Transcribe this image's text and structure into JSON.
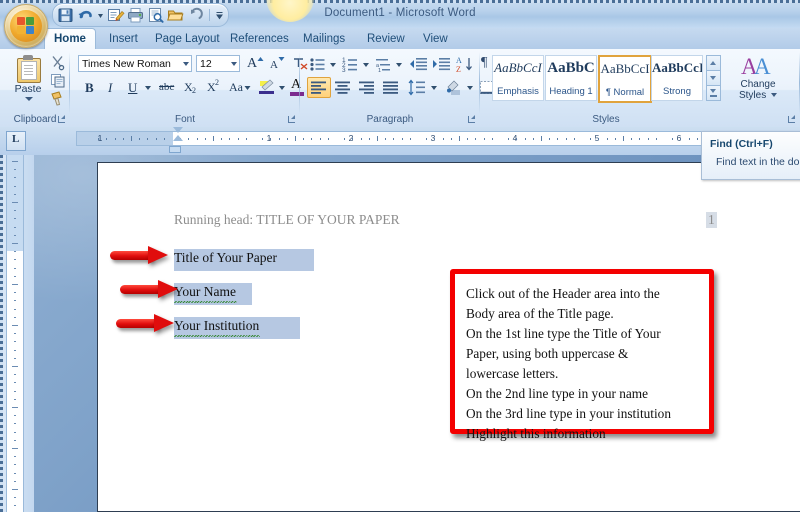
{
  "window": {
    "title": "Document1 - Microsoft Word",
    "office_button": "office-orb"
  },
  "quick_access": {
    "items": [
      {
        "name": "save-icon",
        "tip": "Save"
      },
      {
        "name": "undo-icon",
        "tip": "Undo"
      },
      {
        "name": "undo-dropdown-icon",
        "tip": "Undo options"
      },
      {
        "name": "quick-edit-icon",
        "tip": "Edit"
      },
      {
        "name": "print-icon",
        "tip": "Quick Print"
      },
      {
        "name": "print-preview-icon",
        "tip": "Print Preview"
      },
      {
        "name": "open-icon",
        "tip": "Open"
      },
      {
        "name": "redo-icon",
        "tip": "Redo"
      },
      {
        "name": "customize-qat-icon",
        "tip": "Customize Quick Access Toolbar"
      }
    ]
  },
  "ribbon": {
    "tabs": [
      {
        "label": "Home",
        "active": true
      },
      {
        "label": "Insert",
        "active": false
      },
      {
        "label": "Page Layout",
        "active": false
      },
      {
        "label": "References",
        "active": false
      },
      {
        "label": "Mailings",
        "active": false
      },
      {
        "label": "Review",
        "active": false
      },
      {
        "label": "View",
        "active": false
      }
    ],
    "groups": [
      {
        "label": "Clipboard"
      },
      {
        "label": "Font"
      },
      {
        "label": "Paragraph"
      },
      {
        "label": "Styles"
      }
    ],
    "clipboard": {
      "paste_label": "Paste",
      "cut_icon": "scissors-icon",
      "copy_icon": "copy-icon",
      "format_painter_icon": "format-painter-icon"
    },
    "font": {
      "font_name": "Times New Roman",
      "font_size": "12",
      "grow_font": "A",
      "shrink_font": "A",
      "clear_formatting_icon": "clear-formatting-icon",
      "bold": "B",
      "italic": "I",
      "underline": "U",
      "strikethrough": "abc",
      "subscript": "X",
      "superscript": "X",
      "change_case": "Aa",
      "highlight_icon": "text-highlight-icon",
      "font_color": "A"
    },
    "paragraph": {
      "bullets_icon": "bullets-icon",
      "numbering_icon": "numbering-icon",
      "multilevel_icon": "multilevel-list-icon",
      "decrease_indent_icon": "decrease-indent-icon",
      "increase_indent_icon": "increase-indent-icon",
      "sort_icon": "sort-icon",
      "show_marks_icon": "show-formatting-marks-icon",
      "align_left_icon": "align-left-icon",
      "align_center_icon": "align-center-icon",
      "align_right_icon": "align-right-icon",
      "justify_icon": "justify-icon",
      "line_spacing_icon": "line-spacing-icon",
      "shading_icon": "shading-icon",
      "borders_icon": "borders-icon"
    },
    "styles": {
      "gallery": [
        {
          "sample": "AaBbCcI",
          "name": "Emphasis",
          "selected": false
        },
        {
          "sample": "AaBbC",
          "name": "Heading 1",
          "selected": false
        },
        {
          "sample": "AaBbCcI",
          "name": "¶ Normal",
          "selected": true
        },
        {
          "sample": "AaBbCcI",
          "name": "Strong",
          "selected": false
        }
      ],
      "change_styles_line1": "Change",
      "change_styles_line2": "Styles"
    }
  },
  "ruler": {
    "tab_selector": "L",
    "h_numbers": [
      "1",
      "1",
      "2",
      "3",
      "4",
      "5",
      "6"
    ]
  },
  "tooltip": {
    "title": "Find (Ctrl+F)",
    "body": "Find text in the doc"
  },
  "document": {
    "header_text": "Running head: TITLE OF YOUR PAPER",
    "page_number": "1",
    "body_lines": [
      "Title of Your Paper",
      "Your Name",
      "Your Institution"
    ]
  },
  "callout": {
    "lines": [
      "Click out of the Header area into the",
      "Body area of the Title page.",
      "On the 1st line type the Title of Your",
      "Paper, using both uppercase &",
      "lowercase letters.",
      "On the 2nd line type in your name",
      "On the 3rd line type in your institution",
      "Highlight this information"
    ],
    "border_color": "#f40000"
  },
  "annotations": {
    "arrow_count": 3,
    "arrow_color": "#e00d0d"
  },
  "colors": {
    "selection_highlight": "#b6c8e2",
    "ribbon_accent": "#1f4e79",
    "active_style_border": "#e0a33d"
  }
}
